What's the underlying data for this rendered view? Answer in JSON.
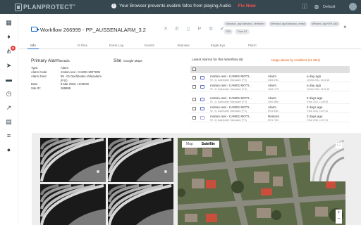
{
  "topbar": {
    "logo_text": "PLANPROTECT",
    "logo_mark": "®",
    "banner_text": "Your Browser prevents evalink fafos from playing Audio",
    "fix_now": "Fix Now",
    "default_label": "Default",
    "icons": [
      "info-circle-icon",
      "globe-icon",
      "user-avatar"
    ]
  },
  "sidebar": {
    "items": [
      "dashboard-icon",
      "alarm-bell-icon",
      "hierarchy-icon",
      "send-icon",
      "folder-icon",
      "history-icon",
      "chart-icon",
      "reports-icon",
      "list-icon",
      "person-icon"
    ],
    "badge": "9"
  },
  "workflow": {
    "title": "Workflow 266999 - PP_AUSSENALARM_3.2",
    "chips": [
      "Videobox_tag:Videobox_Verifiziert",
      "MProtect_tag:Videobox_verbal",
      "MProtect_tag:VFH-G82",
      "TSO",
      "Thor+UT"
    ],
    "close": "×"
  },
  "tabs": [
    "Info",
    "D Files",
    "Event Log",
    "Events",
    "Statuses",
    "Eagle Eye",
    "PlanC"
  ],
  "primary_alarm": {
    "title": "Primary Alarm",
    "details_label": "Details",
    "rows": [
      {
        "key": "Type:",
        "value": "Alarm"
      },
      {
        "key": "Alarm Code:",
        "value": "motion.real - CAM01 MOTION"
      },
      {
        "key": "Alarm Zone:",
        "value": "99 - 01 Dachboden Videoalarm (P E)"
      },
      {
        "key": "Date:",
        "value": "9 Mar 2022, 13:08:09"
      },
      {
        "key": "Site ID:",
        "value": "266999"
      }
    ]
  },
  "site": {
    "title": "Site",
    "link": "Google Maps"
  },
  "latest_alarms": {
    "title": "Latest Alarms for this Workflow (6)",
    "assign_link": "Assign alarms by conditions (11 sites)",
    "rows": [
      {
        "name": "motion.real - CAM01 MOTI...",
        "sub": "99 - 01 Dachboden Videoalarm (P E)",
        "type": "Alarm",
        "id": "1084 4754",
        "time": "a day ago",
        "date": "10 Mar 2022, 13:22:18"
      },
      {
        "name": "motion.real - CAM01 MOTI...",
        "sub": "99 - 01 Dachboden Videoalarm (P E)",
        "type": "Alarm",
        "id": "1084 1778",
        "time": "a day ago",
        "date": "10 Mar 2022, 13:21:18"
      },
      {
        "name": "motion.real - CAM01 MOTI...",
        "sub": "99 - 01 Dachboden Videoalarm (P E)",
        "type": "Alarm",
        "id": "4260 8896",
        "time": "2 days ago",
        "date": "9 Mar 2022, 13:08:09"
      },
      {
        "name": "motion.real - CAM01 MOTI...",
        "sub": "99 - 01 Dachboden Videoalarm (P E)",
        "type": "Alarm",
        "id": "8761 8030",
        "time": "2 days ago",
        "date": "9 Mar 2022, 13:07:40"
      },
      {
        "name": "motion.real - CAM01 MOTI...",
        "sub": "99 - 01 Dachboden Videoalarm (P E)",
        "type": "Restore",
        "id": "8701 7103",
        "time": "2 days ago",
        "date": "9 Mar 2022, 13:07:40"
      }
    ]
  },
  "map": {
    "tabs": [
      "Map",
      "Satellite"
    ],
    "active_tab": "Satellite",
    "zoom_in": "+",
    "zoom_out": "−",
    "fullscreen": "⛶"
  },
  "colors": {
    "topbar": "#37474f",
    "accent": "#1565c0",
    "alert": "#e53935",
    "assign": "#e65100"
  }
}
